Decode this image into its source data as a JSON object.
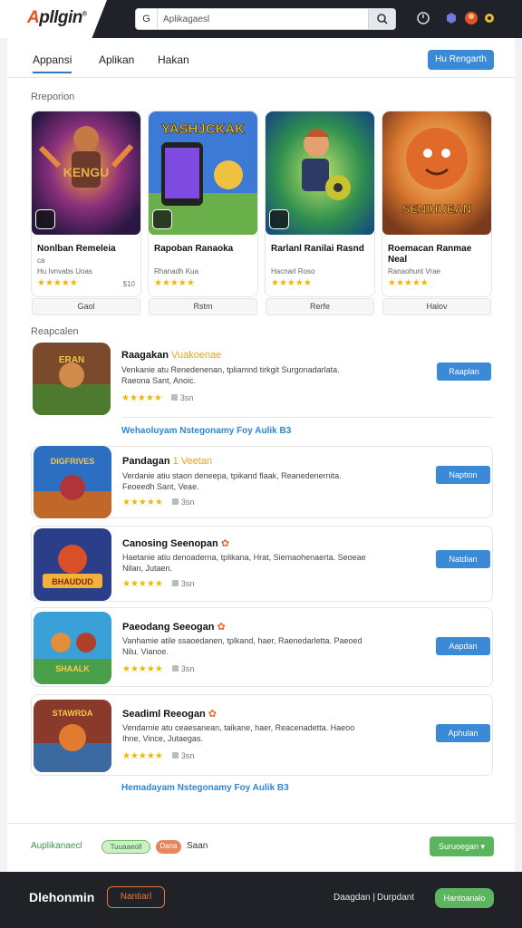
{
  "header": {
    "logo_first": "A",
    "logo_rest": "pllgin",
    "logo_mark": "®",
    "search_prefix": "G",
    "search_value": "Aplikagaesl",
    "icons": [
      "dashboard-icon",
      "puzzle-icon",
      "avatar-icon",
      "settings-gear-icon"
    ]
  },
  "tabs": [
    "Appansi",
    "Aplikan",
    "Hakan"
  ],
  "header_button": "Hu Rengarth",
  "featured": {
    "label": "Rreporion",
    "cards": [
      {
        "title": "Nonlban Remeleia",
        "line2": "ca",
        "sub": "Hu Ivnvabs Uoas",
        "stars": "★★★★★",
        "price": "$10",
        "button": "Gaol",
        "art_text": "KENGU"
      },
      {
        "title": "Rapoban Ranaoka",
        "line2": "",
        "sub": "Rhanadh Kua",
        "stars": "★★★★★",
        "price": "",
        "button": "Rstm",
        "art_text": "YASHJCKAK"
      },
      {
        "title": "Rarlanl Ranilai Rasnd",
        "line2": "",
        "sub": "Hacnarl Roso",
        "stars": "★★★★★",
        "price": "",
        "button": "Rerfe",
        "art_text": ""
      },
      {
        "title": "Roemacan Ranmae Neal",
        "line2": "",
        "sub": "Ranaohunt Vrae",
        "stars": "★★★★★",
        "price": "",
        "button": "Halov",
        "art_text": "SENIHUEAN"
      }
    ]
  },
  "list": {
    "label": "Reapcalen",
    "items": [
      {
        "title": "Raagakan",
        "tag": "Vuakoenae",
        "desc": "Venkanie atu Renedenenan, tpliamnd tirkgit Surgonadarlata. Raeona Sant, Anoic.",
        "stars": "★★★★★",
        "meta": "3sn",
        "button": "Raaplan",
        "art_text": "ERAN"
      },
      {
        "title": "Pandagan",
        "tag": "1 Veetan",
        "desc": "Verdanie atiu staon deneepa, tpikand flaak, Reanedenernita. Feoeedh Sant, Veae.",
        "stars": "★★★★★",
        "meta": "3sn",
        "button": "Naption",
        "art_text": "DIGFRIVES"
      },
      {
        "title": "Canosing Seenopan",
        "tag": "",
        "desc": "Haetanie atiu denoaderna, tplikana, Hrat, Siemaohenaerta. Seoeae Nilan, Jutaen.",
        "stars": "★★★★★",
        "meta": "3sn",
        "button": "Natdian",
        "art_text": "BHAUDUD"
      },
      {
        "title": "Paeodang Seeogan",
        "tag": "",
        "desc": "Vanhamie atile ssaoedanen, tplkand, haer, Raenedarletta. Paeoed Nilu. Vianoe.",
        "stars": "★★★★★",
        "meta": "3sn",
        "button": "Aapdan",
        "art_text": "SHAALK"
      },
      {
        "title": "Seadiml Reeogan",
        "tag": "",
        "desc": "Vendarnie atu ceaesanean, taikane, haer, Reacenadetta. Haeoo Ihne, Vince, Jutaegas.",
        "stars": "★★★★★",
        "meta": "3sn",
        "button": "Aphulan",
        "art_text": "STAWRDA"
      }
    ],
    "link_1": "Wehaoluyam Nstegonamy Foy Aulik B3",
    "link_2": "Hemadayam Nstegonamy Foy Aulik B3"
  },
  "footer": {
    "label": "Auplikanaecl",
    "pill_green": "Tuuaaeoll",
    "pill_orange": "Dana",
    "text": "Saan",
    "button": "Suruoegan ▾"
  },
  "bottom_bar": {
    "logo": "Dlehonmin",
    "outline_button": "Nantiarl",
    "link_1": "Daagdan |",
    "link_2": "Durpdant",
    "green_button": "Hantoanalo"
  },
  "colors": {
    "accent_blue": "#3a8ad8",
    "star": "#f1b800",
    "header_dark": "#1f2228",
    "logo_orange": "#e8501e",
    "green": "#5ab55e"
  }
}
